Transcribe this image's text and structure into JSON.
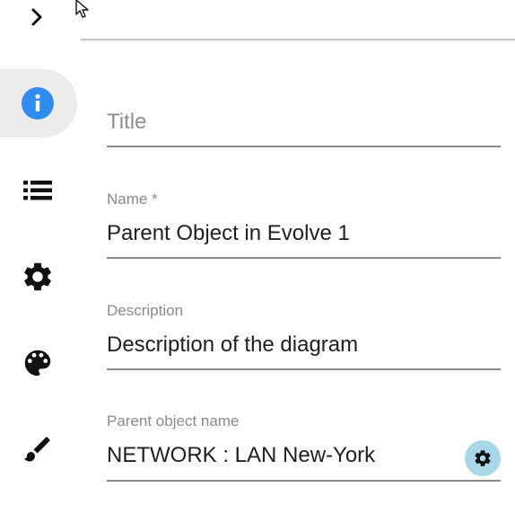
{
  "sidebar": {
    "toggle_icon": "chevron-right-icon",
    "items": [
      {
        "name": "info",
        "icon": "info-icon",
        "active": true
      },
      {
        "name": "list",
        "icon": "list-icon",
        "active": false
      },
      {
        "name": "settings",
        "icon": "gear-icon",
        "active": false
      },
      {
        "name": "palette",
        "icon": "palette-icon",
        "active": false
      },
      {
        "name": "brush",
        "icon": "brush-icon",
        "active": false
      }
    ]
  },
  "form": {
    "title": {
      "placeholder": "Title",
      "value": ""
    },
    "name": {
      "label": "Name *",
      "value": "Parent Object in Evolve 1"
    },
    "description": {
      "label": "Description",
      "value": "Description of the diagram"
    },
    "parent": {
      "label": "Parent object name",
      "value": "NETWORK : LAN New-York",
      "action_icon": "gear-icon"
    }
  },
  "colors": {
    "accent": "#2f8cf0",
    "gear_button_bg": "#a9d7ea",
    "active_nav_bg": "#ececec"
  }
}
